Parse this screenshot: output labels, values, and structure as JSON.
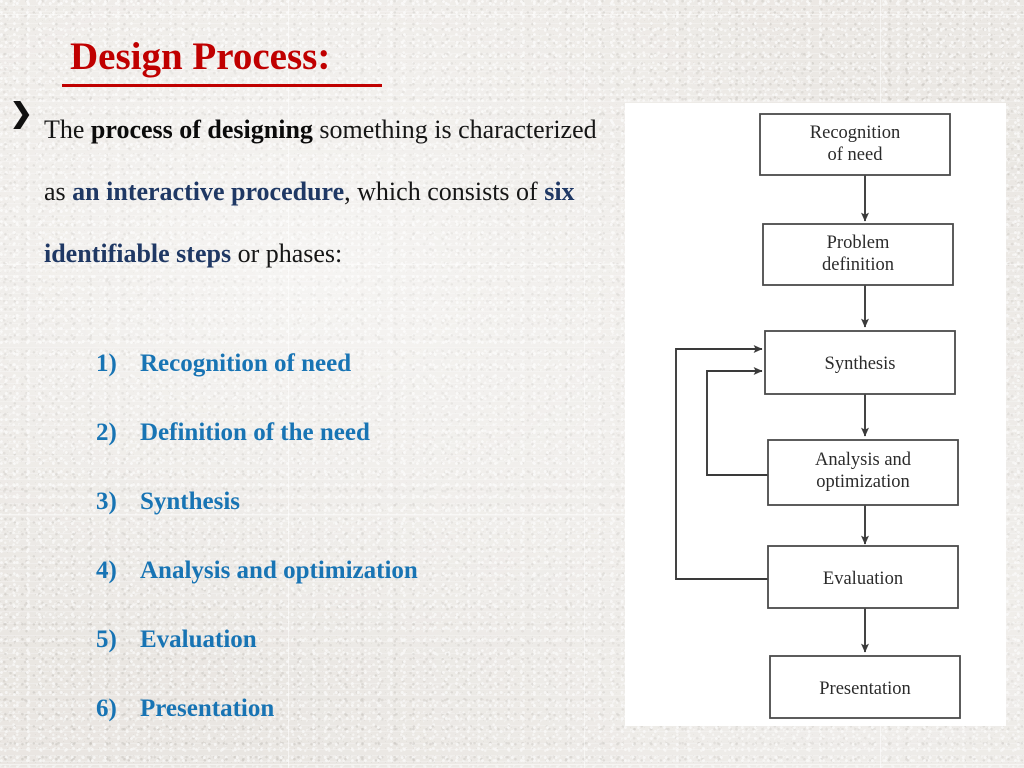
{
  "slide": {
    "title": "Design Process:",
    "bullet_marker": "❯"
  },
  "paragraph": {
    "seg1": "The ",
    "seg2_bold": "process of designing",
    "seg3": " something is characterized as ",
    "seg4_bold": "an interactive procedure",
    "seg5": ", which consists of ",
    "seg6_bold": "six identifiable steps",
    "seg7": " or phases:"
  },
  "steps": [
    {
      "num": "1)",
      "label": "Recognition of need"
    },
    {
      "num": "2)",
      "label": "Definition of the need"
    },
    {
      "num": "3)",
      "label": "Synthesis"
    },
    {
      "num": "4)",
      "label": "Analysis and optimization"
    },
    {
      "num": "5)",
      "label": "Evaluation"
    },
    {
      "num": "6)",
      "label": "Presentation"
    }
  ],
  "flowchart": {
    "boxes": [
      {
        "id": "recognition",
        "line1": "Recognition",
        "line2": "of need"
      },
      {
        "id": "problem",
        "line1": "Problem",
        "line2": "definition"
      },
      {
        "id": "synthesis",
        "line1": "Synthesis",
        "line2": ""
      },
      {
        "id": "analysis",
        "line1": "Analysis and",
        "line2": "optimization"
      },
      {
        "id": "evaluation",
        "line1": "Evaluation",
        "line2": ""
      },
      {
        "id": "presentation",
        "line1": "Presentation",
        "line2": ""
      }
    ]
  },
  "colors": {
    "title_red": "#C00000",
    "step_blue": "#1874B4",
    "emphasis_navy": "#1F3864",
    "body_black": "#161616",
    "panel_white": "#FFFFFF",
    "diagram_line": "#3a3a3a"
  }
}
